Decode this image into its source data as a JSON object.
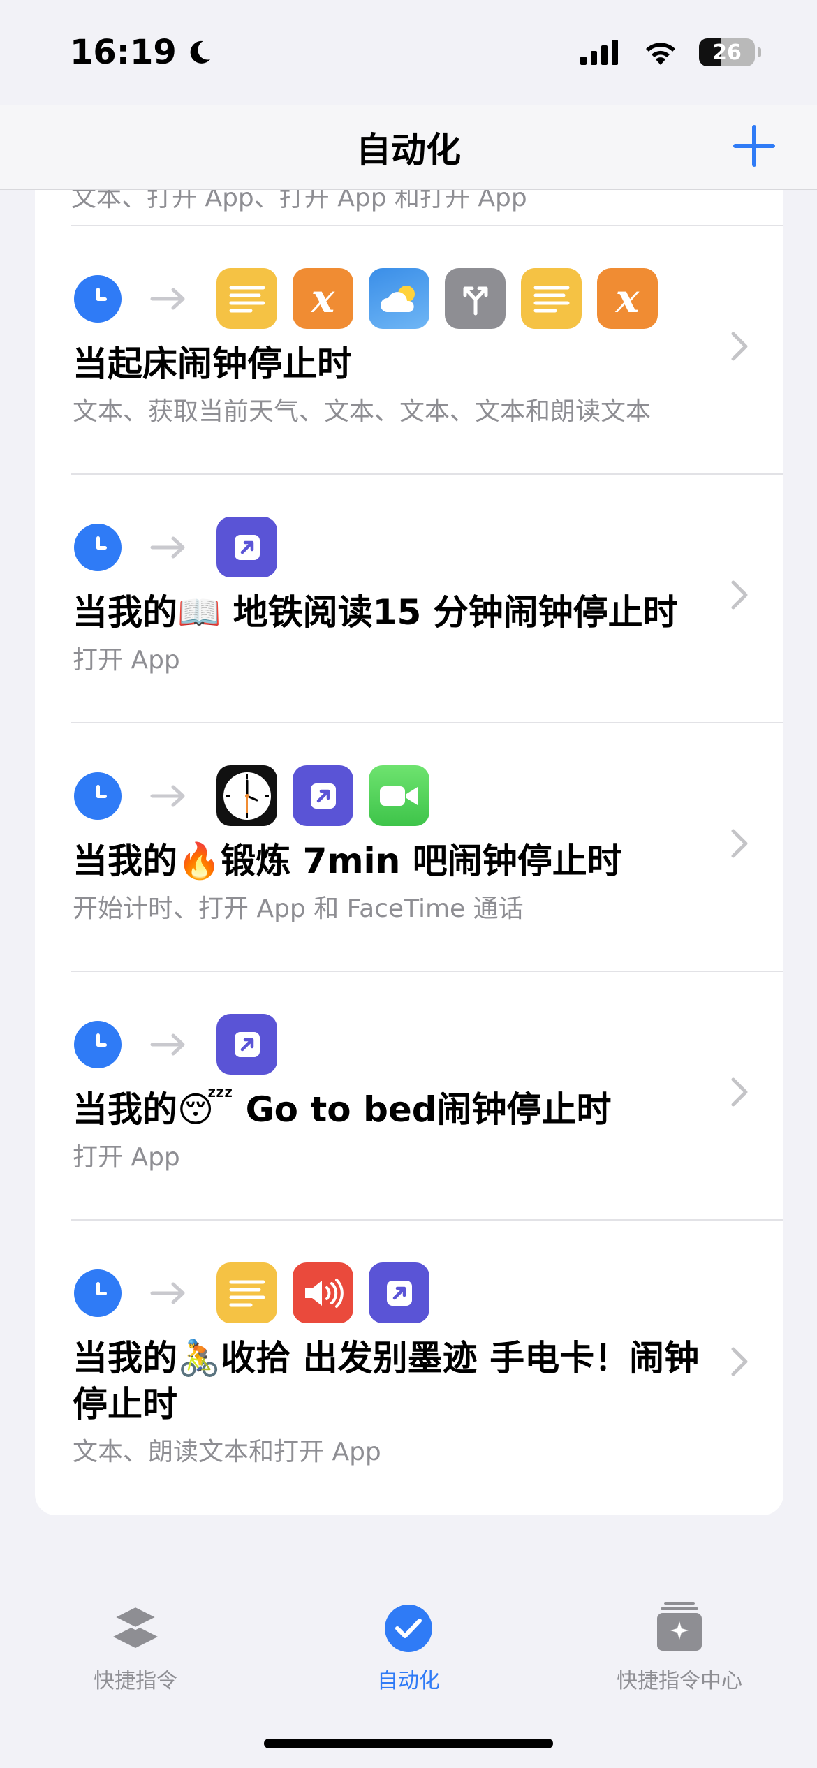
{
  "status": {
    "time": "16:19",
    "battery": "26"
  },
  "nav": {
    "title": "自动化"
  },
  "partial_row_text": "文本、打开 App、打开 App 和打开 App",
  "automations": [
    {
      "title": "当起床闹钟停止时",
      "subtitle": "文本、获取当前天气、文本、文本、文本和朗读文本",
      "icons": [
        "text-icon",
        "variable-icon",
        "weather-icon",
        "if-icon",
        "text-icon",
        "variable-icon"
      ]
    },
    {
      "title": "当我的📖 地铁阅读15 分钟闹钟停止时",
      "subtitle": "打开 App",
      "icons": [
        "open-app-icon"
      ]
    },
    {
      "title": "当我的🔥锻炼 7min 吧闹钟停止时",
      "subtitle": "开始计时、打开 App 和 FaceTime 通话",
      "icons": [
        "clock-app-icon",
        "open-app-icon",
        "facetime-icon"
      ]
    },
    {
      "title": "当我的😴 Go to bed闹钟停止时",
      "subtitle": "打开 App",
      "icons": [
        "open-app-icon"
      ]
    },
    {
      "title": "当我的🚴收拾 出发别墨迹 手电卡！闹钟停止时",
      "subtitle": "文本、朗读文本和打开 App",
      "icons": [
        "text-icon",
        "speak-icon",
        "open-app-icon"
      ]
    }
  ],
  "tabs": [
    {
      "label": "快捷指令",
      "active": false,
      "icon": "layers-icon"
    },
    {
      "label": "自动化",
      "active": true,
      "icon": "checkmark-circle-icon"
    },
    {
      "label": "快捷指令中心",
      "active": false,
      "icon": "gallery-icon"
    }
  ],
  "colors": {
    "accent": "#2f7bf6",
    "inactive": "#8e8e93"
  }
}
